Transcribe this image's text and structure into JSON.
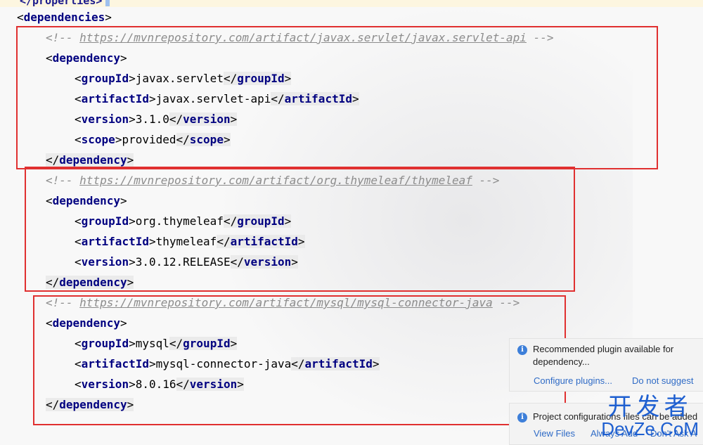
{
  "editor": {
    "prev_line": "</properties>",
    "dependencies_open": "dependencies",
    "groups": [
      {
        "comment_url": "https://mvnrepository.com/artifact/javax.servlet/javax.servlet-api",
        "group_id": "javax.servlet",
        "artifact_id": "javax.servlet-api",
        "version": "3.1.0",
        "scope": "provided"
      },
      {
        "comment_url": "https://mvnrepository.com/artifact/org.thymeleaf/thymeleaf",
        "group_id": "org.thymeleaf",
        "artifact_id": "thymeleaf",
        "version": "3.0.12.RELEASE"
      },
      {
        "comment_url": "https://mvnrepository.com/artifact/mysql/mysql-connector-java",
        "group_id": "mysql",
        "artifact_id": "mysql-connector-java",
        "version": "8.0.16"
      }
    ],
    "tags": {
      "dependency": "dependency",
      "groupId": "groupId",
      "artifactId": "artifactId",
      "version": "version",
      "scope": "scope"
    }
  },
  "notifications": {
    "plugin": {
      "message": "Recommended plugin available for dependency...",
      "action_configure": "Configure plugins...",
      "action_dismiss": "Do not suggest"
    },
    "project": {
      "message": "Project configurations files can be added",
      "action_view": "View Files",
      "action_always": "Always Add",
      "action_never": "Don't Ask A"
    }
  },
  "watermark": {
    "cn": "开发者",
    "en": "DevZe.CoM"
  },
  "colors": {
    "tag": "#000080",
    "comment": "#8c8c8c",
    "highlight_box": "#e03030",
    "link": "#2f6bc6"
  }
}
